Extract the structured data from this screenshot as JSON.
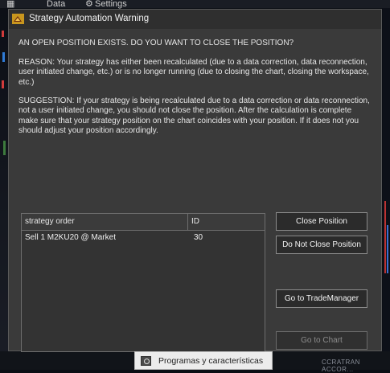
{
  "background": {
    "menu": [
      "Data",
      "Settings"
    ],
    "status_text": "CCRATRAN ACCOR..."
  },
  "dialog": {
    "title": "Strategy Automation Warning",
    "message_heading": "AN OPEN POSITION EXISTS.  DO YOU WANT TO CLOSE THE POSITION?",
    "reason": "REASON:  Your strategy has either been recalculated (due to a data correction, data reconnection, user initiated change, etc.) or is no longer running (due to closing the chart, closing the workspace, etc.)",
    "suggestion": "SUGGESTION:  If your strategy is being recalculated due to a data correction or data reconnection, not a user initiated change, you should not close the position.  After the calculation is complete make sure that your strategy position on the chart coincides with your position.  If it does not you should adjust your position accordingly.",
    "table": {
      "columns": [
        "strategy order",
        "ID"
      ],
      "rows": [
        {
          "order": "Sell 1 M2KU20 @ Market",
          "id": "30"
        }
      ]
    },
    "buttons": {
      "close_position": "Close Position",
      "do_not_close_position": "Do Not Close Position",
      "go_to_trademanager": "Go to TradeManager",
      "go_to_chart": "Go to Chart"
    }
  },
  "tooltip": {
    "text": "Programas y características"
  }
}
